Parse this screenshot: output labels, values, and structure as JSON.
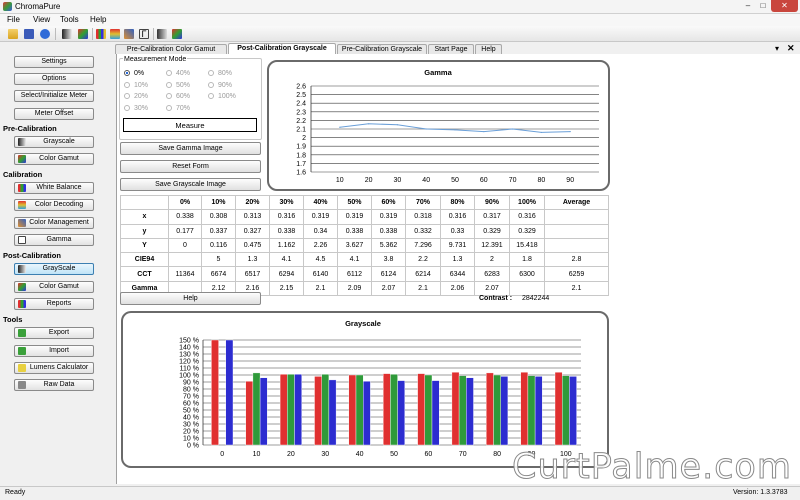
{
  "window": {
    "title": "ChromaPure",
    "min": "–",
    "max": "□",
    "close": "✕"
  },
  "menu": [
    "File",
    "View",
    "Tools",
    "Help"
  ],
  "toolbar_icons": [
    "open-icon",
    "save-icon",
    "help-icon",
    "grayscale-icon",
    "gamut-icon",
    "colorbars-icon",
    "decoding-icon",
    "gamma-icon",
    "grayscale-icon-2",
    "gamut-icon-2"
  ],
  "tabs": [
    "Pre-Calibration Color Gamut",
    "Post-Calibration Grayscale",
    "Pre-Calibration Grayscale",
    "Start Page",
    "Help"
  ],
  "active_tab": 1,
  "panel": {
    "close_glyph": "▾",
    "x_glyph": "✕"
  },
  "sidebar": {
    "top_buttons": [
      "Settings",
      "Options",
      "Select/Initialize Meter",
      "Meter Offset"
    ],
    "sections": [
      {
        "title": "Pre-Calibration",
        "items": [
          "Grayscale",
          "Color Gamut"
        ]
      },
      {
        "title": "Calibration",
        "items": [
          "White Balance",
          "Color Decoding",
          "Color Management",
          "Gamma"
        ]
      },
      {
        "title": "Post-Calibration",
        "items": [
          "GrayScale",
          "Color Gamut",
          "Reports"
        ]
      },
      {
        "title": "Tools",
        "items": [
          "Export",
          "Import",
          "Lumens Calculator",
          "Raw Data"
        ]
      }
    ],
    "active_item": "GrayScale"
  },
  "measurement_mode": {
    "legend": "Measurement Mode",
    "options": [
      "0%",
      "10%",
      "20%",
      "30%",
      "40%",
      "50%",
      "60%",
      "70%",
      "80%",
      "90%",
      "100%"
    ],
    "selected": "0%",
    "measure_label": "Measure"
  },
  "actions": {
    "save_gamma": "Save Gamma Image",
    "reset": "Reset Form",
    "save_grayscale": "Save Grayscale Image",
    "help": "Help"
  },
  "table": {
    "columns": [
      "",
      "0%",
      "10%",
      "20%",
      "30%",
      "40%",
      "50%",
      "60%",
      "70%",
      "80%",
      "90%",
      "100%",
      "Average"
    ],
    "rows": [
      [
        "x",
        "0.338",
        "0.308",
        "0.313",
        "0.316",
        "0.319",
        "0.319",
        "0.319",
        "0.318",
        "0.316",
        "0.317",
        "0.316",
        ""
      ],
      [
        "y",
        "0.177",
        "0.337",
        "0.327",
        "0.338",
        "0.34",
        "0.338",
        "0.338",
        "0.332",
        "0.33",
        "0.329",
        "0.329",
        ""
      ],
      [
        "Y",
        "0",
        "0.116",
        "0.475",
        "1.162",
        "2.26",
        "3.627",
        "5.362",
        "7.296",
        "9.731",
        "12.391",
        "15.418",
        ""
      ],
      [
        "CIE94",
        "",
        "5",
        "1.3",
        "4.1",
        "4.5",
        "4.1",
        "3.8",
        "2.2",
        "1.3",
        "2",
        "1.8",
        "2.8"
      ],
      [
        "CCT",
        "11364",
        "6674",
        "6517",
        "6294",
        "6140",
        "6112",
        "6124",
        "6214",
        "6344",
        "6283",
        "6300",
        "6259"
      ],
      [
        "Gamma",
        "",
        "2.12",
        "2.16",
        "2.15",
        "2.1",
        "2.09",
        "2.07",
        "2.1",
        "2.06",
        "2.07",
        "",
        "2.1"
      ]
    ]
  },
  "contrast": {
    "label": "Contrast :",
    "value": "2842244"
  },
  "status": {
    "left": "Ready",
    "right": "Version: 1.3.3783"
  },
  "watermark": "CurtPalme.com",
  "chart_data": [
    {
      "type": "line",
      "title": "Gamma",
      "x": [
        10,
        20,
        30,
        40,
        50,
        60,
        70,
        80,
        90
      ],
      "y": [
        2.12,
        2.16,
        2.15,
        2.1,
        2.09,
        2.07,
        2.1,
        2.06,
        2.07
      ],
      "ylim": [
        1.6,
        2.6
      ],
      "yticks": [
        "2.6",
        "2.5",
        "2.4",
        "2.3",
        "2.2",
        "2.1",
        "2",
        "1.9",
        "1.8",
        "1.7",
        "1.6"
      ],
      "xticks": [
        "10",
        "20",
        "30",
        "40",
        "50",
        "60",
        "70",
        "80",
        "90"
      ],
      "grid": true,
      "color": "#6a9fd8"
    },
    {
      "type": "bar",
      "title": "Grayscale",
      "categories": [
        "0",
        "10",
        "20",
        "30",
        "40",
        "50",
        "60",
        "70",
        "80",
        "90",
        "100"
      ],
      "series": [
        {
          "color": "#e03030",
          "values": [
            150,
            91,
            101,
            98,
            100,
            102,
            102,
            104,
            103,
            104,
            104
          ]
        },
        {
          "color": "#2f9a3a",
          "values": [
            0,
            103,
            101,
            101,
            100,
            101,
            100,
            99,
            100,
            99,
            99
          ]
        },
        {
          "color": "#2c2cd0",
          "values": [
            150,
            96,
            101,
            93,
            91,
            92,
            92,
            96,
            98,
            98,
            98
          ]
        }
      ],
      "ylim": [
        0,
        150
      ],
      "yticks": [
        "150 %",
        "140 %",
        "130 %",
        "120 %",
        "110 %",
        "100 %",
        "90 %",
        "80 %",
        "70 %",
        "60 %",
        "50 %",
        "40 %",
        "30 %",
        "20 %",
        "10 %",
        "0 %"
      ],
      "grid": true
    }
  ]
}
